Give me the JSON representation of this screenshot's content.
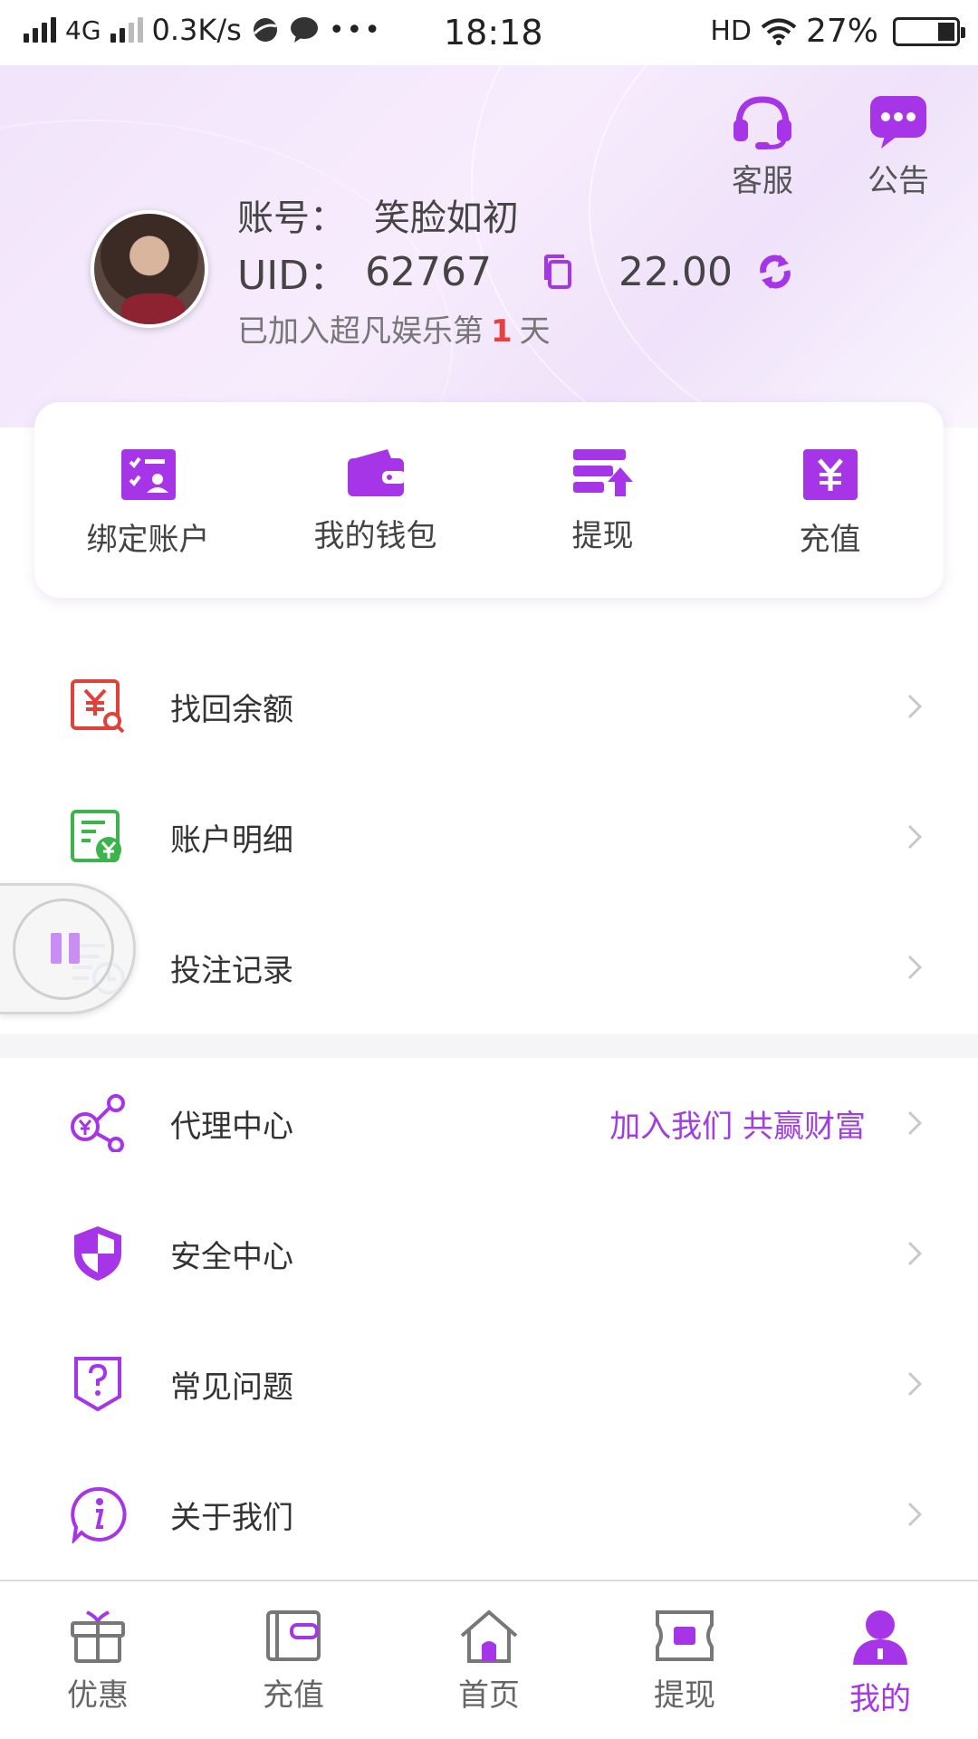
{
  "status_bar": {
    "network": "4G",
    "speed": "0.3K/s",
    "time": "18:18",
    "hd": "HD",
    "battery": "27%"
  },
  "header": {
    "service_label": "客服",
    "notice_label": "公告",
    "account_label": "账号：",
    "account_name": "笑脸如初",
    "uid_label": "UID：",
    "uid_value": "62767",
    "balance": "22.00",
    "joined_prefix": "已加入超凡娱乐第",
    "joined_days": "1",
    "joined_suffix": "天"
  },
  "quick_actions": [
    {
      "label": "绑定账户",
      "icon": "bind-account-icon"
    },
    {
      "label": "我的钱包",
      "icon": "wallet-icon"
    },
    {
      "label": "提现",
      "icon": "withdraw-icon"
    },
    {
      "label": "充值",
      "icon": "recharge-icon"
    }
  ],
  "menu_group_1": [
    {
      "label": "找回余额",
      "icon": "recover-balance-icon"
    },
    {
      "label": "账户明细",
      "icon": "account-details-icon"
    },
    {
      "label": "投注记录",
      "icon": "bet-records-icon"
    }
  ],
  "menu_group_2": [
    {
      "label": "代理中心",
      "icon": "agent-center-icon",
      "extra": "加入我们 共赢财富"
    },
    {
      "label": "安全中心",
      "icon": "security-shield-icon"
    },
    {
      "label": "常见问题",
      "icon": "faq-icon"
    },
    {
      "label": "关于我们",
      "icon": "about-info-icon"
    }
  ],
  "tab_bar": [
    {
      "label": "优惠",
      "icon": "gift-icon",
      "active": false
    },
    {
      "label": "充值",
      "icon": "wallet-card-icon",
      "active": false
    },
    {
      "label": "首页",
      "icon": "home-icon",
      "active": false
    },
    {
      "label": "提现",
      "icon": "cash-ticket-icon",
      "active": false
    },
    {
      "label": "我的",
      "icon": "user-icon",
      "active": true
    }
  ],
  "colors": {
    "accent": "#a735e8",
    "accent_text": "#a03ee0",
    "days_red": "#e64040",
    "recover_red": "#e0413a",
    "details_green": "#3cb44b",
    "bets_blue": "#4a8fe0"
  }
}
